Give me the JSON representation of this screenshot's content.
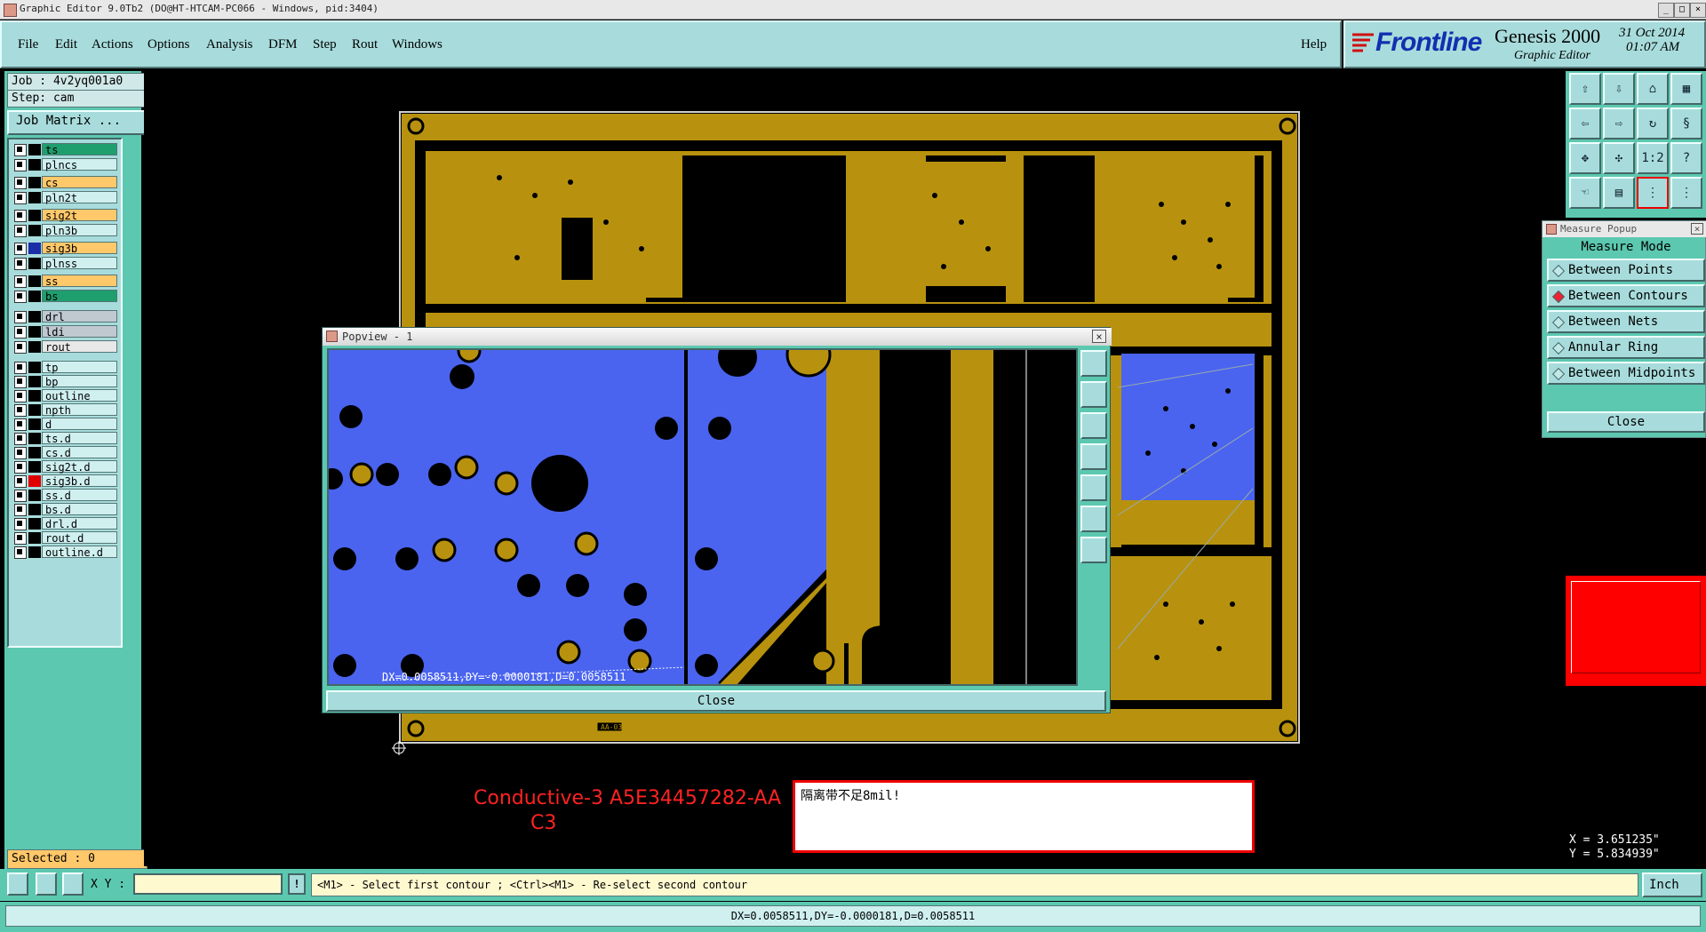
{
  "window": {
    "title": "Graphic Editor 9.0Tb2 (DO@HT-HTCAM-PC066 - Windows, pid:3404)"
  },
  "menubar": {
    "items": [
      "File",
      "Edit",
      "Actions",
      "Options",
      "Analysis",
      "DFM",
      "Step",
      "Rout",
      "Windows"
    ],
    "help": "Help"
  },
  "brand": {
    "logo": "Frontline",
    "product": "Genesis 2000",
    "subtitle": "Graphic Editor",
    "date": "31 Oct 2014",
    "time": "01:07 AM"
  },
  "job": {
    "job_label": "Job : 4v2yq001a0",
    "step_label": "Step: cam",
    "matrix_button": "Job Matrix ..."
  },
  "layers": [
    {
      "name": "ts",
      "color": "#1f9e6e",
      "swatch": "#000"
    },
    {
      "name": "plncs",
      "color": "#d0f0f0",
      "swatch": "#000"
    },
    {
      "name": "cs",
      "color": "#ffc86a",
      "swatch": "#000"
    },
    {
      "name": "pln2t",
      "color": "#d0f0f0",
      "swatch": "#000"
    },
    {
      "name": "sig2t",
      "color": "#ffc86a",
      "swatch": "#000"
    },
    {
      "name": "pln3b",
      "color": "#d0f0f0",
      "swatch": "#000"
    },
    {
      "name": "sig3b",
      "color": "#ffc86a",
      "swatch": "#1a2ea8"
    },
    {
      "name": "plnss",
      "color": "#d0f0f0",
      "swatch": "#000"
    },
    {
      "name": "ss",
      "color": "#ffc86a",
      "swatch": "#000"
    },
    {
      "name": "bs",
      "color": "#1f9e6e",
      "swatch": "#000"
    },
    {
      "name": "drl",
      "color": "#c0c8d0",
      "swatch": "#000"
    },
    {
      "name": "ldi",
      "color": "#c0c8d0",
      "swatch": "#000"
    },
    {
      "name": "rout",
      "color": "#e8e8e8",
      "swatch": "#000"
    },
    {
      "name": "tp",
      "color": "#d0f0f0",
      "swatch": "#000"
    },
    {
      "name": "bp",
      "color": "#d0f0f0",
      "swatch": "#000"
    },
    {
      "name": "outline",
      "color": "#d0f0f0",
      "swatch": "#000"
    },
    {
      "name": "npth",
      "color": "#d0f0f0",
      "swatch": "#000"
    },
    {
      "name": "d",
      "color": "#d0f0f0",
      "swatch": "#000"
    },
    {
      "name": "ts.d",
      "color": "#d0f0f0",
      "swatch": "#000"
    },
    {
      "name": "cs.d",
      "color": "#d0f0f0",
      "swatch": "#000"
    },
    {
      "name": "sig2t.d",
      "color": "#d0f0f0",
      "swatch": "#000"
    },
    {
      "name": "sig3b.d",
      "color": "#d0f0f0",
      "swatch": "#e00000"
    },
    {
      "name": "ss.d",
      "color": "#d0f0f0",
      "swatch": "#000"
    },
    {
      "name": "bs.d",
      "color": "#d0f0f0",
      "swatch": "#000"
    },
    {
      "name": "drl.d",
      "color": "#d0f0f0",
      "swatch": "#000"
    },
    {
      "name": "rout.d",
      "color": "#d0f0f0",
      "swatch": "#000"
    },
    {
      "name": "outline.d",
      "color": "#d0f0f0",
      "swatch": "#000"
    }
  ],
  "selected": "Selected : 0",
  "popview": {
    "title": "Popview - 1",
    "readout": "DX=0.0058511,DY=-0.0000181,D=0.0058511",
    "close": "Close"
  },
  "measure": {
    "title": "Measure Popup",
    "header": "Measure Mode",
    "options": [
      {
        "label": "Between Points",
        "selected": false
      },
      {
        "label": "Between Contours",
        "selected": true
      },
      {
        "label": "Between Nets",
        "selected": false
      },
      {
        "label": "Annular Ring",
        "selected": false
      },
      {
        "label": "Between Midpoints",
        "selected": false
      }
    ],
    "close": "Close"
  },
  "annotation": {
    "line1": "Conductive-3 A5E34457282-AA",
    "line2": "C3",
    "marker": "AA-03"
  },
  "message": "隔离带不足8mil!",
  "coords": {
    "x": "X = 3.651235\"",
    "y": "Y = 5.834939\""
  },
  "cmdbar": {
    "xy_label": "X Y :",
    "xy_value": "",
    "prompt": "<M1> - Select first contour ; <Ctrl><M1> - Re-select second contour",
    "units": "Inch"
  },
  "statusbar": {
    "text": "DX=0.0058511,DY=-0.0000181,D=0.0058511"
  },
  "colors": {
    "board_copper": "#b8920e",
    "highlight_blue": "#4a64f0",
    "panel_teal": "#5cc8b0",
    "button_teal": "#a8dcdc"
  }
}
